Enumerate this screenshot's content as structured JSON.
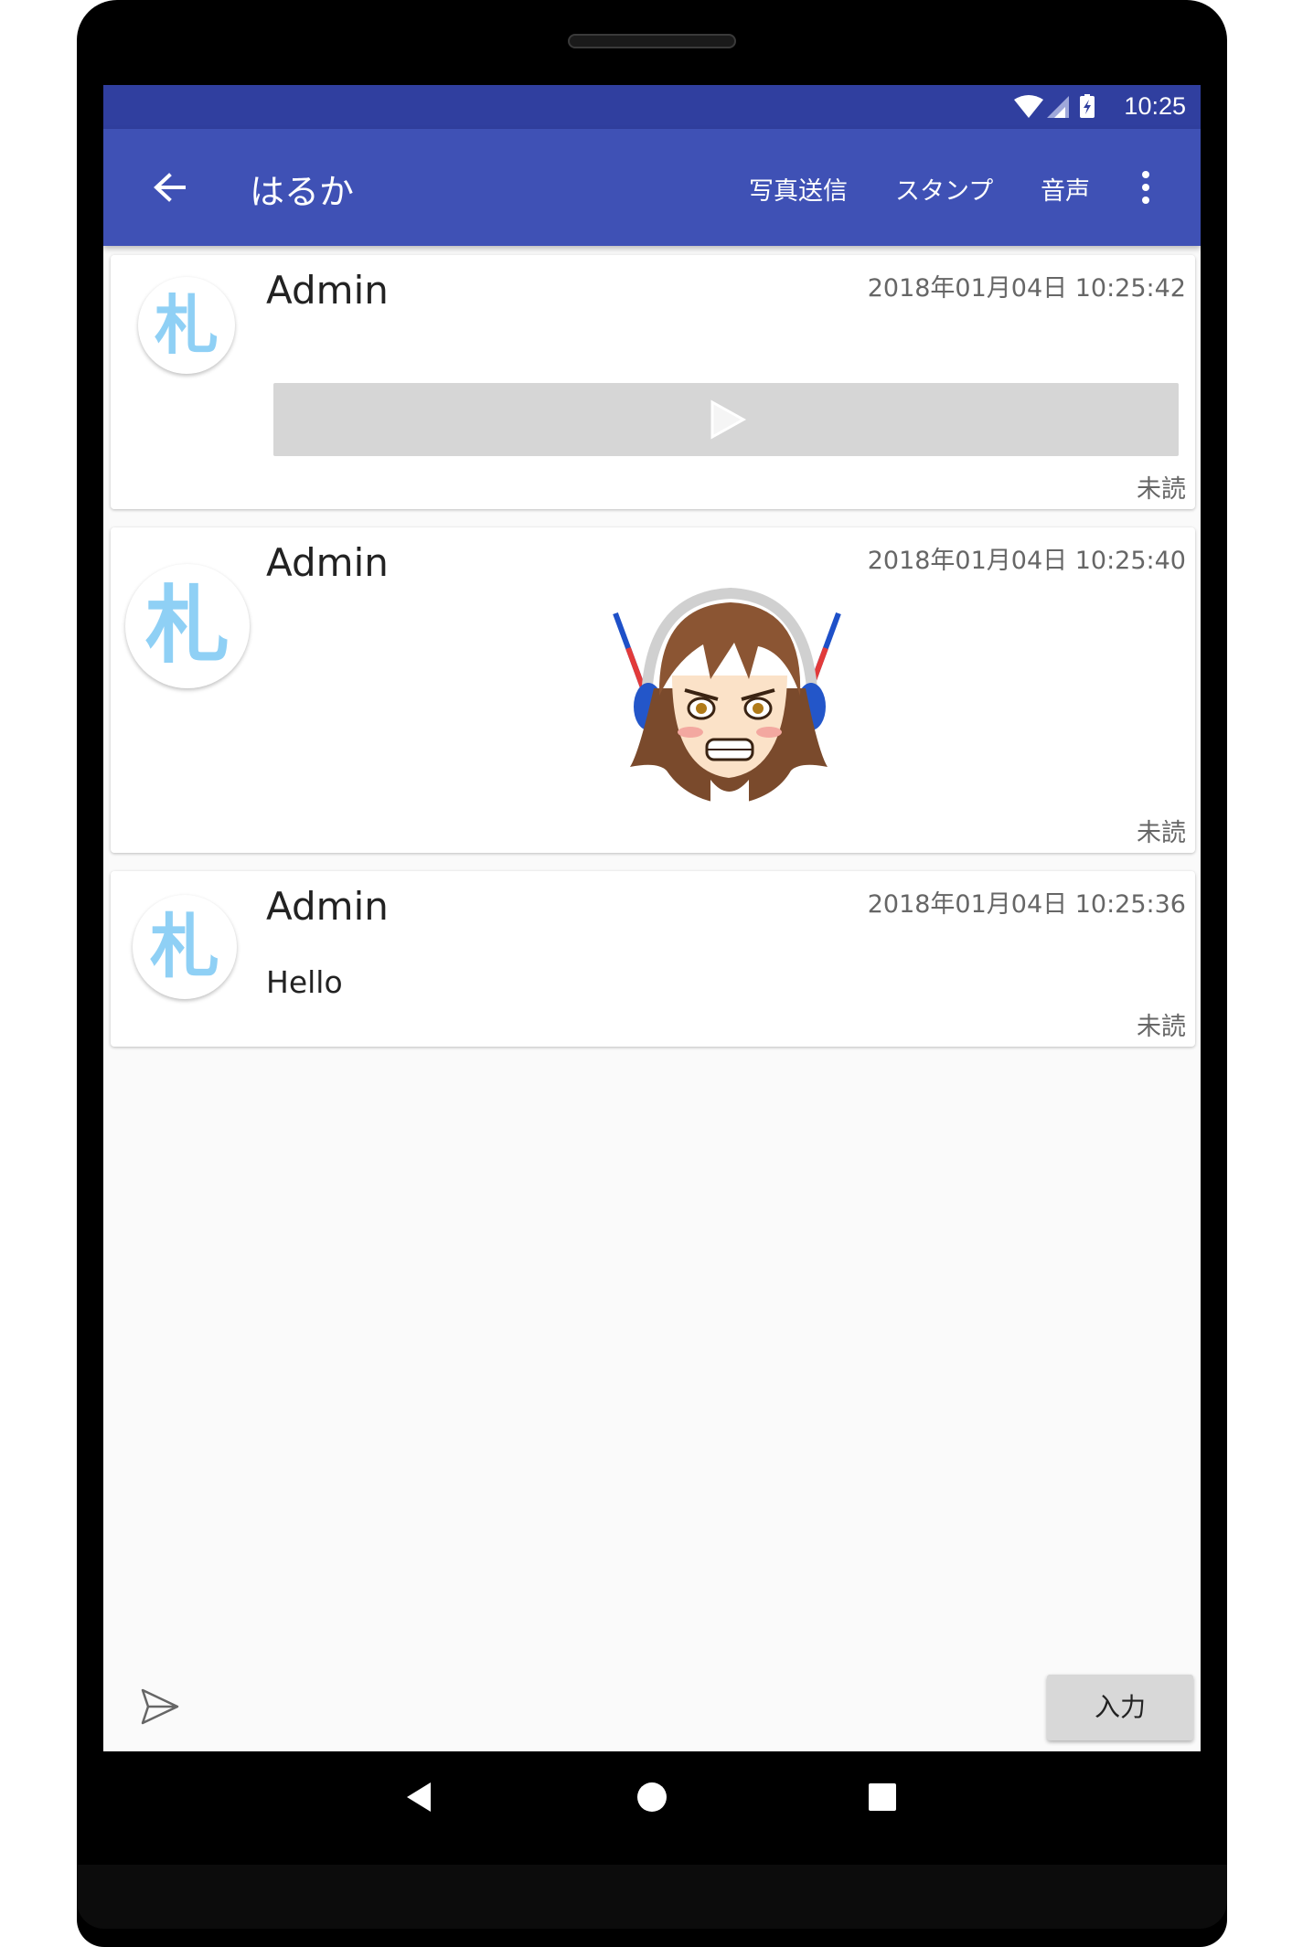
{
  "status_bar": {
    "time": "10:25",
    "icons": [
      "wifi-icon",
      "cell-signal-icon",
      "battery-charging-icon"
    ]
  },
  "toolbar": {
    "title": "はるか",
    "actions": [
      "写真送信",
      "スタンプ",
      "音声"
    ],
    "back_icon": "arrow-left-icon",
    "overflow_icon": "more-vert-icon"
  },
  "messages": [
    {
      "sender": "Admin",
      "timestamp": "2018年01月04日 10:25:42",
      "type": "audio",
      "status": "未読",
      "avatar_char": "札"
    },
    {
      "sender": "Admin",
      "timestamp": "2018年01月04日 10:25:40",
      "type": "sticker",
      "status": "未読",
      "avatar_char": "札"
    },
    {
      "sender": "Admin",
      "timestamp": "2018年01月04日 10:25:36",
      "type": "text",
      "text": "Hello",
      "status": "未読",
      "avatar_char": "札"
    }
  ],
  "composer": {
    "input_label": "入力",
    "send_icon": "send-icon"
  },
  "nav_bar": {
    "buttons": [
      "back-triangle-icon",
      "home-circle-icon",
      "recents-square-icon"
    ]
  },
  "colors": {
    "status_bar": "#303f9f",
    "toolbar": "#3f51b5",
    "background": "#fafafa",
    "avatar_char": "#8fd0f5"
  }
}
